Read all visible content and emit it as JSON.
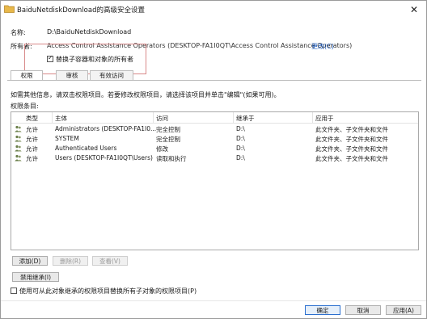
{
  "window": {
    "title": "BaiduNetdiskDownload的高级安全设置",
    "close_glyph": "✕"
  },
  "name_row": {
    "label": "名称:",
    "value": "D:\\BaiduNetdiskDownload"
  },
  "owner_row": {
    "label": "所有者:",
    "value": "Access Control Assistance Operators (DESKTOP-FA1I0QT\\Access Control Assistance Operators)",
    "change_link": "更改(C)"
  },
  "replace_owner_checkbox": {
    "label": "替换子容器和对象的所有者",
    "checked": true
  },
  "tabs": [
    {
      "label": "权限",
      "active": true
    },
    {
      "label": "审核",
      "active": false
    },
    {
      "label": "有效访问",
      "active": false
    }
  ],
  "info_text": "如需其他信息，请双击权限项目。若要修改权限项目，请选择该项目并单击\"编辑\"(如果可用)。",
  "entries_label": "权限条目:",
  "table": {
    "headers": [
      "类型",
      "主体",
      "访问",
      "继承于",
      "应用于"
    ],
    "rows": [
      {
        "type": "允许",
        "principal": "Administrators (DESKTOP-FA1I0...",
        "access": "完全控制",
        "inherited": "D:\\",
        "applies": "此文件夹、子文件夹和文件"
      },
      {
        "type": "允许",
        "principal": "SYSTEM",
        "access": "完全控制",
        "inherited": "D:\\",
        "applies": "此文件夹、子文件夹和文件"
      },
      {
        "type": "允许",
        "principal": "Authenticated Users",
        "access": "修改",
        "inherited": "D:\\",
        "applies": "此文件夹、子文件夹和文件"
      },
      {
        "type": "允许",
        "principal": "Users (DESKTOP-FA1I0QT\\Users)",
        "access": "读取和执行",
        "inherited": "D:\\",
        "applies": "此文件夹、子文件夹和文件"
      }
    ]
  },
  "list_buttons": {
    "add": "添加(D)",
    "remove": "删除(R)",
    "view": "查看(V)"
  },
  "disable_inheritance": "禁用继承(I)",
  "replace_child_checkbox": {
    "label": "使用可从此对象继承的权限项目替换所有子对象的权限项目(P)",
    "checked": false
  },
  "footer": {
    "ok": "确定",
    "cancel": "取消",
    "apply": "应用(A)"
  },
  "colors": {
    "accent": "#2b6fcf",
    "link": "#1f5dbf",
    "highlight_box": "#d98a8a",
    "folder": "#e8b84a"
  },
  "icons": {
    "title": "folder-icon",
    "principal": "users-icon"
  }
}
